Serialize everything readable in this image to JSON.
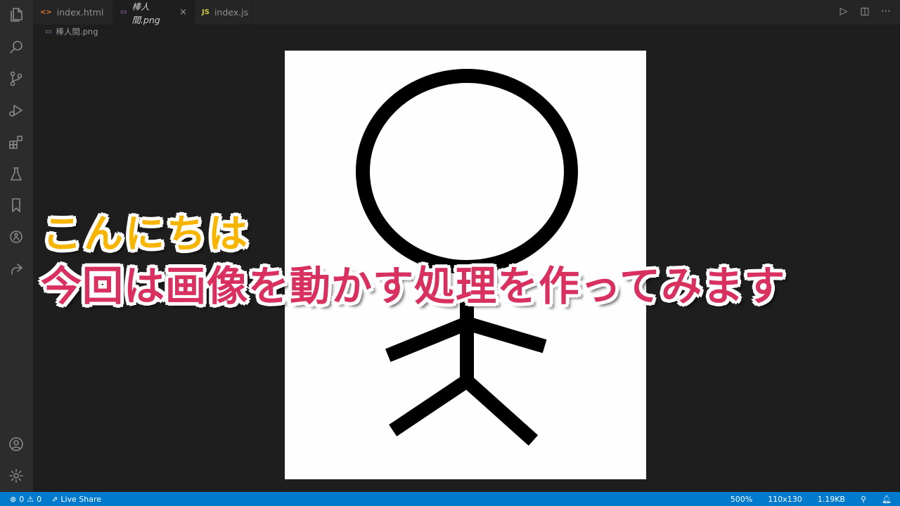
{
  "tabs": [
    {
      "label": "index.html",
      "icon": "<>",
      "icon_color": "#e37933",
      "active": false
    },
    {
      "label": "棒人間.png",
      "icon": "▭",
      "icon_color": "#b180d7",
      "active": true
    },
    {
      "label": "index.js",
      "icon": "JS",
      "icon_color": "#cbcb41",
      "active": false
    }
  ],
  "tab_close_glyph": "×",
  "breadcrumb": {
    "icon": "▭",
    "label": "棒人間.png"
  },
  "captions": {
    "line1": "こんにちは",
    "line2": "今回は画像を動かす処理を作ってみます"
  },
  "status": {
    "errors": "0",
    "warnings": "0",
    "live_share": "Live Share",
    "zoom": "500%",
    "dimensions": "110x130",
    "file_size": "1.19KB"
  },
  "icons": {
    "activity": [
      "explorer-icon",
      "search-icon",
      "source-control-icon",
      "run-debug-icon",
      "extensions-icon",
      "testing-icon",
      "bookmark-icon",
      "github-icon",
      "live-share-icon",
      "account-icon",
      "settings-gear-icon"
    ],
    "tab_actions": [
      "run-icon",
      "split-editor-icon",
      "more-actions-icon"
    ]
  }
}
